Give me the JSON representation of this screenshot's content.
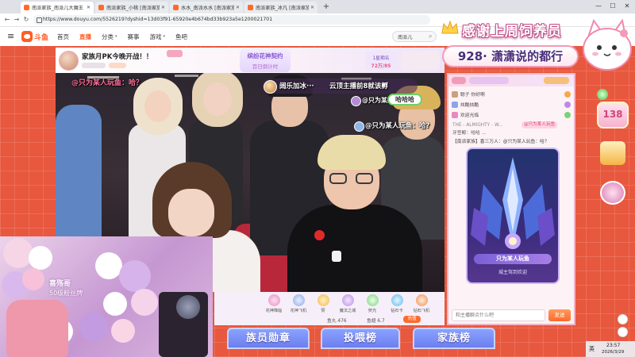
{
  "browser": {
    "tabs": [
      {
        "title": "南派家族_南派儿大魔王 - 直..."
      },
      {
        "title": "南派家族_小桃 [南派家族] 南..."
      },
      {
        "title": "水水_南派水水 [南派家族] 南..."
      },
      {
        "title": "南派家族_冰凡 [南派家族] 南..."
      }
    ],
    "tab_close": "✕",
    "new_tab": "+",
    "url": "https://www.douyu.com/5526219?dyshid=13d03f91-65920e4b674bd33b923a5e1200021701",
    "controls": {
      "minimize": "—",
      "maximize": "☐",
      "close": "✕"
    },
    "nav_icons": {
      "back": "←",
      "forward": "→",
      "reload": "↻"
    }
  },
  "site": {
    "menu_icon": "≡",
    "logo": "斗鱼",
    "nav": [
      {
        "label": "首页"
      },
      {
        "label": "直播"
      },
      {
        "label": "分类"
      },
      {
        "label": "赛事"
      },
      {
        "label": "游戏"
      },
      {
        "label": "鱼吧"
      }
    ],
    "chevron": "▾",
    "search_value": "南派儿",
    "search_icon": "⌕"
  },
  "overlay": {
    "thanks": "感谢上周饲养员",
    "feeder": "928· 潇潇说的都行"
  },
  "room": {
    "title": "家族月PK今晚开战！！",
    "event_title": "缤纷花神契约",
    "event_sub": "百日倒计时",
    "rank_label": "1星期名",
    "rank_value": "72万/85"
  },
  "danmaku": [
    {
      "text": "@只为某人玩鱼：哈？"
    },
    {
      "user": "阔乐加冰···",
      "text": "云顶主播前8就该孵"
    },
    {
      "text": "@只为某人玩..."
    },
    {
      "text": "哈哈哈"
    },
    {
      "text": "@只为某人玩鱼：哈?"
    }
  ],
  "pip": {
    "name": "喜殇哥",
    "badge": "50级粉丝牌"
  },
  "gifts": [
    {
      "name": "花神降临"
    },
    {
      "name": "花神飞机"
    },
    {
      "name": "赞"
    },
    {
      "name": "魔法之城"
    },
    {
      "name": "荧光"
    },
    {
      "name": "钻石卡"
    },
    {
      "name": "钻石飞机"
    }
  ],
  "wallet": {
    "yuwan": "鱼丸 476",
    "yuchi": "鱼翅 6.7",
    "recharge": "充值"
  },
  "banners": [
    "族员勋章",
    "投喂榜",
    "家族榜"
  ],
  "chat": {
    "rows": [
      {
        "text": "聪子 你好啊"
      },
      {
        "text": "炫酷炫酷"
      },
      {
        "text": "欢迎光临"
      }
    ],
    "messages": [
      {
        "text": "THE - ALMIGHTY - W..."
      },
      {
        "text": "牙签鲸：哈哈 ..."
      },
      {
        "text": "【南派家族】喜三万人：@只为某人玩鱼：哈？"
      }
    ],
    "mention": "@只为某人玩鱼",
    "input_placeholder": "和主播聊点什么吧",
    "send": "发送"
  },
  "entrance": {
    "user": "只为某人玩鱼",
    "text": "城主驾到欢迎"
  },
  "side": {
    "badge_count": "138"
  },
  "taskbar": {
    "ime": "英",
    "time": "23:57",
    "date": "2026/3/29"
  },
  "colors": {
    "brand": "#ff5d23",
    "page_bg": "#e8583e",
    "banner": "#7b8cf2",
    "chat_border": "#f3b6c8",
    "overlay_outline": "#c2508a"
  },
  "icons": [
    "menu-icon",
    "douyu-logo-icon",
    "search-icon",
    "crown-icon",
    "cat-mascot-icon",
    "chevron-down-icon",
    "scroll-top-icon"
  ]
}
